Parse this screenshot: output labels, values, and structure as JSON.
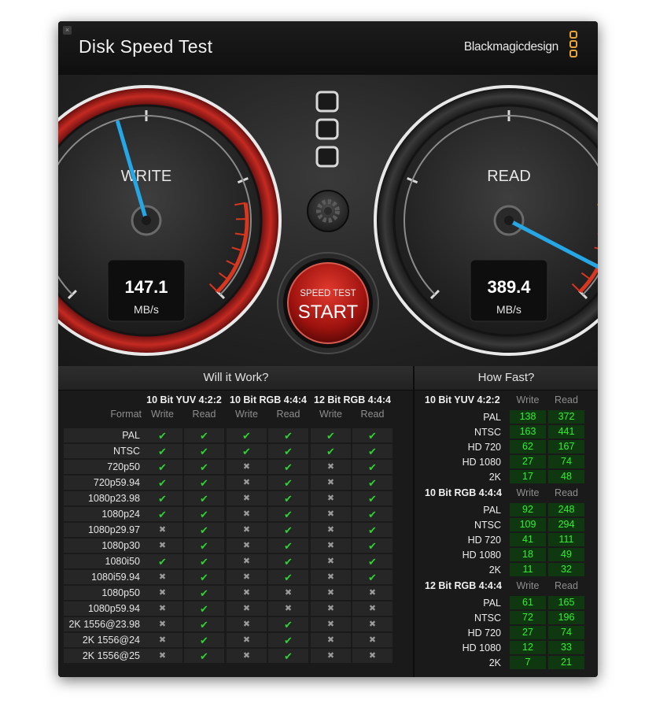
{
  "app": {
    "title": "Disk Speed Test",
    "brand": "Blackmagicdesign",
    "close_glyph": "×"
  },
  "write_gauge": {
    "label": "WRITE",
    "value": "147.1",
    "unit": "MB/s",
    "needle_fraction": 0.44
  },
  "read_gauge": {
    "label": "READ",
    "value": "389.4",
    "unit": "MB/s",
    "needle_fraction": 0.935
  },
  "start_button": {
    "top_label": "SPEED TEST",
    "label": "START"
  },
  "icons": {
    "settings": "gear-icon",
    "logo": "blackmagic-logo-icon",
    "ok": "checkmark-icon",
    "no": "cross-icon"
  },
  "will_it_work": {
    "title": "Will it Work?",
    "format_header": "Format",
    "write_header": "Write",
    "read_header": "Read",
    "groups": [
      "10 Bit YUV 4:2:2",
      "10 Bit RGB 4:4:4",
      "12 Bit RGB 4:4:4"
    ],
    "rows": [
      {
        "format": "PAL",
        "cells": [
          true,
          true,
          true,
          true,
          true,
          true
        ]
      },
      {
        "format": "NTSC",
        "cells": [
          true,
          true,
          true,
          true,
          true,
          true
        ]
      },
      {
        "format": "720p50",
        "cells": [
          true,
          true,
          false,
          true,
          false,
          true
        ]
      },
      {
        "format": "720p59.94",
        "cells": [
          true,
          true,
          false,
          true,
          false,
          true
        ]
      },
      {
        "format": "1080p23.98",
        "cells": [
          true,
          true,
          false,
          true,
          false,
          true
        ]
      },
      {
        "format": "1080p24",
        "cells": [
          true,
          true,
          false,
          true,
          false,
          true
        ]
      },
      {
        "format": "1080p29.97",
        "cells": [
          false,
          true,
          false,
          true,
          false,
          true
        ]
      },
      {
        "format": "1080p30",
        "cells": [
          false,
          true,
          false,
          true,
          false,
          true
        ]
      },
      {
        "format": "1080i50",
        "cells": [
          true,
          true,
          false,
          true,
          false,
          true
        ]
      },
      {
        "format": "1080i59.94",
        "cells": [
          false,
          true,
          false,
          true,
          false,
          true
        ]
      },
      {
        "format": "1080p50",
        "cells": [
          false,
          true,
          false,
          false,
          false,
          false
        ]
      },
      {
        "format": "1080p59.94",
        "cells": [
          false,
          true,
          false,
          false,
          false,
          false
        ]
      },
      {
        "format": "2K 1556@23.98",
        "cells": [
          false,
          true,
          false,
          true,
          false,
          false
        ]
      },
      {
        "format": "2K 1556@24",
        "cells": [
          false,
          true,
          false,
          true,
          false,
          false
        ]
      },
      {
        "format": "2K 1556@25",
        "cells": [
          false,
          true,
          false,
          true,
          false,
          false
        ]
      }
    ]
  },
  "how_fast": {
    "title": "How Fast?",
    "write_header": "Write",
    "read_header": "Read",
    "groups": [
      {
        "name": "10 Bit YUV 4:2:2",
        "rows": [
          {
            "format": "PAL",
            "write": "138",
            "read": "372"
          },
          {
            "format": "NTSC",
            "write": "163",
            "read": "441"
          },
          {
            "format": "HD 720",
            "write": "62",
            "read": "167"
          },
          {
            "format": "HD 1080",
            "write": "27",
            "read": "74"
          },
          {
            "format": "2K",
            "write": "17",
            "read": "48"
          }
        ]
      },
      {
        "name": "10 Bit RGB 4:4:4",
        "rows": [
          {
            "format": "PAL",
            "write": "92",
            "read": "248"
          },
          {
            "format": "NTSC",
            "write": "109",
            "read": "294"
          },
          {
            "format": "HD 720",
            "write": "41",
            "read": "111"
          },
          {
            "format": "HD 1080",
            "write": "18",
            "read": "49"
          },
          {
            "format": "2K",
            "write": "11",
            "read": "32"
          }
        ]
      },
      {
        "name": "12 Bit RGB 4:4:4",
        "rows": [
          {
            "format": "PAL",
            "write": "61",
            "read": "165"
          },
          {
            "format": "NTSC",
            "write": "72",
            "read": "196"
          },
          {
            "format": "HD 720",
            "write": "27",
            "read": "74"
          },
          {
            "format": "HD 1080",
            "write": "12",
            "read": "33"
          },
          {
            "format": "2K",
            "write": "7",
            "read": "21"
          }
        ]
      }
    ]
  },
  "colors": {
    "accent_red": "#c8201c",
    "needle_blue": "#25a7e6",
    "ok_green": "#2fd32f",
    "brand_orange": "#e8a43a"
  }
}
